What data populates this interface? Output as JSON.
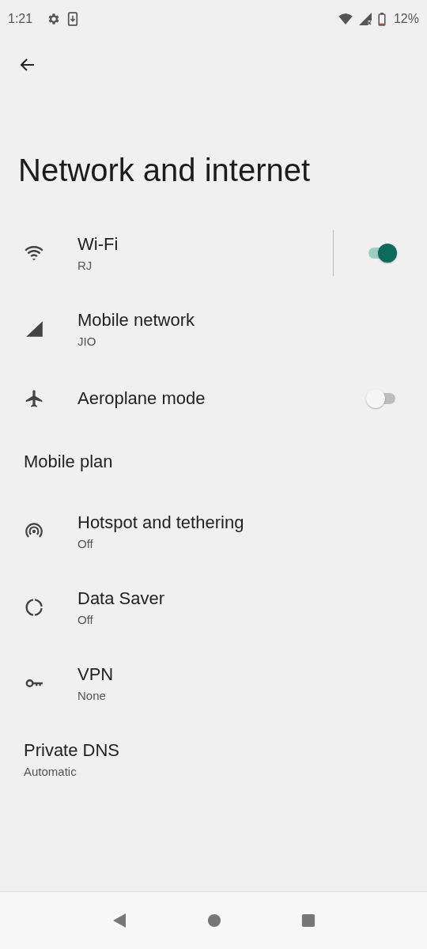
{
  "status_bar": {
    "time": "1:21",
    "battery": "12%"
  },
  "title": "Network and internet",
  "items": [
    {
      "kind": "toggle",
      "title": "Wi-Fi",
      "subtitle": "RJ",
      "on": true
    },
    {
      "kind": "link",
      "title": "Mobile network",
      "subtitle": "JIO"
    },
    {
      "kind": "toggle",
      "title": "Aeroplane mode",
      "on": false
    },
    {
      "kind": "plain",
      "title": "Mobile plan"
    },
    {
      "kind": "link",
      "title": "Hotspot and tethering",
      "subtitle": "Off"
    },
    {
      "kind": "link",
      "title": "Data Saver",
      "subtitle": "Off"
    },
    {
      "kind": "link",
      "title": "VPN",
      "subtitle": "None"
    },
    {
      "kind": "plain",
      "title": "Private DNS",
      "subtitle": "Automatic"
    }
  ]
}
